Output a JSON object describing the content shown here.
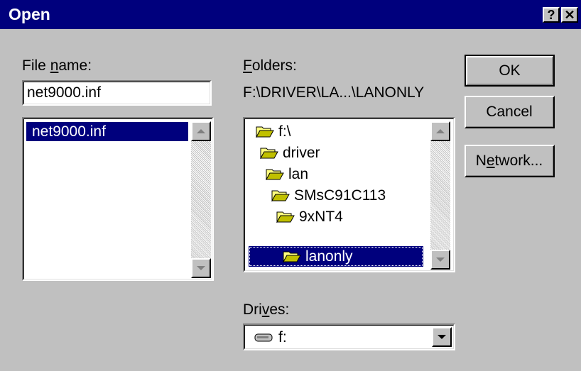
{
  "window": {
    "title": "Open",
    "help_label": "?",
    "close_label": "✕"
  },
  "file_name": {
    "label_pre": "File ",
    "label_key": "n",
    "label_post": "ame:",
    "value": "net9000.inf",
    "list": [
      "net9000.inf"
    ],
    "selected_index": 0
  },
  "folders": {
    "label_key": "F",
    "label_post": "olders:",
    "current_path": "F:\\DRIVER\\LA...\\LANONLY",
    "items": [
      {
        "label": "f:\\",
        "icon": "open-folder-icon"
      },
      {
        "label": "driver",
        "icon": "open-folder-icon"
      },
      {
        "label": "lan",
        "icon": "open-folder-icon"
      },
      {
        "label": "SMsC91C113",
        "icon": "open-folder-icon"
      },
      {
        "label": "9xNT4",
        "icon": "open-folder-icon"
      },
      {
        "label": "lanonly",
        "icon": "open-folder-icon"
      }
    ],
    "selected_index": 5
  },
  "drives": {
    "label_pre": "Dri",
    "label_key": "v",
    "label_post": "es:",
    "value": "f:",
    "icon": "hard-drive-icon"
  },
  "buttons": {
    "ok": "OK",
    "cancel": "Cancel",
    "network_pre": "N",
    "network_key": "e",
    "network_post": "twork..."
  },
  "colors": {
    "titlebar": "#00007d",
    "face": "#c0c0c0",
    "selection": "#00007d"
  }
}
